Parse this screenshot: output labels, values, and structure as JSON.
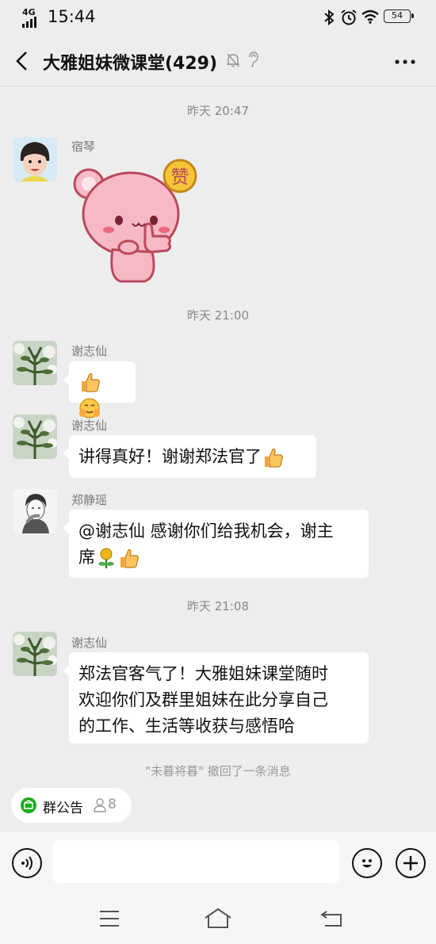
{
  "status_bar": {
    "network": "4G",
    "time": "15:44",
    "battery": "54"
  },
  "header": {
    "title": "大雅姐妹微课堂(429)"
  },
  "messages": [
    {
      "type": "time",
      "text": "昨天 20:47"
    },
    {
      "type": "sticker",
      "sender": "宿琴",
      "sticker": "pink-bear-thumbs-up",
      "sticker_text": "赞"
    },
    {
      "type": "time",
      "text": "昨天 21:00"
    },
    {
      "type": "text",
      "sender": "谢志仙",
      "text": "",
      "emojis": [
        "thumbs-up-emoji",
        "hug-emoji"
      ]
    },
    {
      "type": "text",
      "sender": "谢志仙",
      "text": "讲得真好！谢谢郑法官了",
      "emojis": [
        "thumbs-up-emoji"
      ]
    },
    {
      "type": "text",
      "sender": "郑静瑶",
      "line1": "@谢志仙  感谢你们给我机会，谢主",
      "line2": "席",
      "emojis": [
        "rose-emoji",
        "thumbs-up-emoji"
      ]
    },
    {
      "type": "time",
      "text": "昨天 21:08"
    },
    {
      "type": "text",
      "sender": "谢志仙",
      "lines": [
        "郑法官客气了！大雅姐妹课堂随时",
        "欢迎你们及群里姐妹在此分享自己",
        "的工作、生活等收获与感悟哈"
      ]
    },
    {
      "type": "system",
      "text": "\"未暮将暮\" 撤回了一条消息"
    }
  ],
  "notice": {
    "label": "群公告",
    "count": "8"
  },
  "input": {
    "value": ""
  },
  "colors": {
    "background": "#ededed",
    "bubble": "#ffffff",
    "notice_green": "#1aad19"
  }
}
